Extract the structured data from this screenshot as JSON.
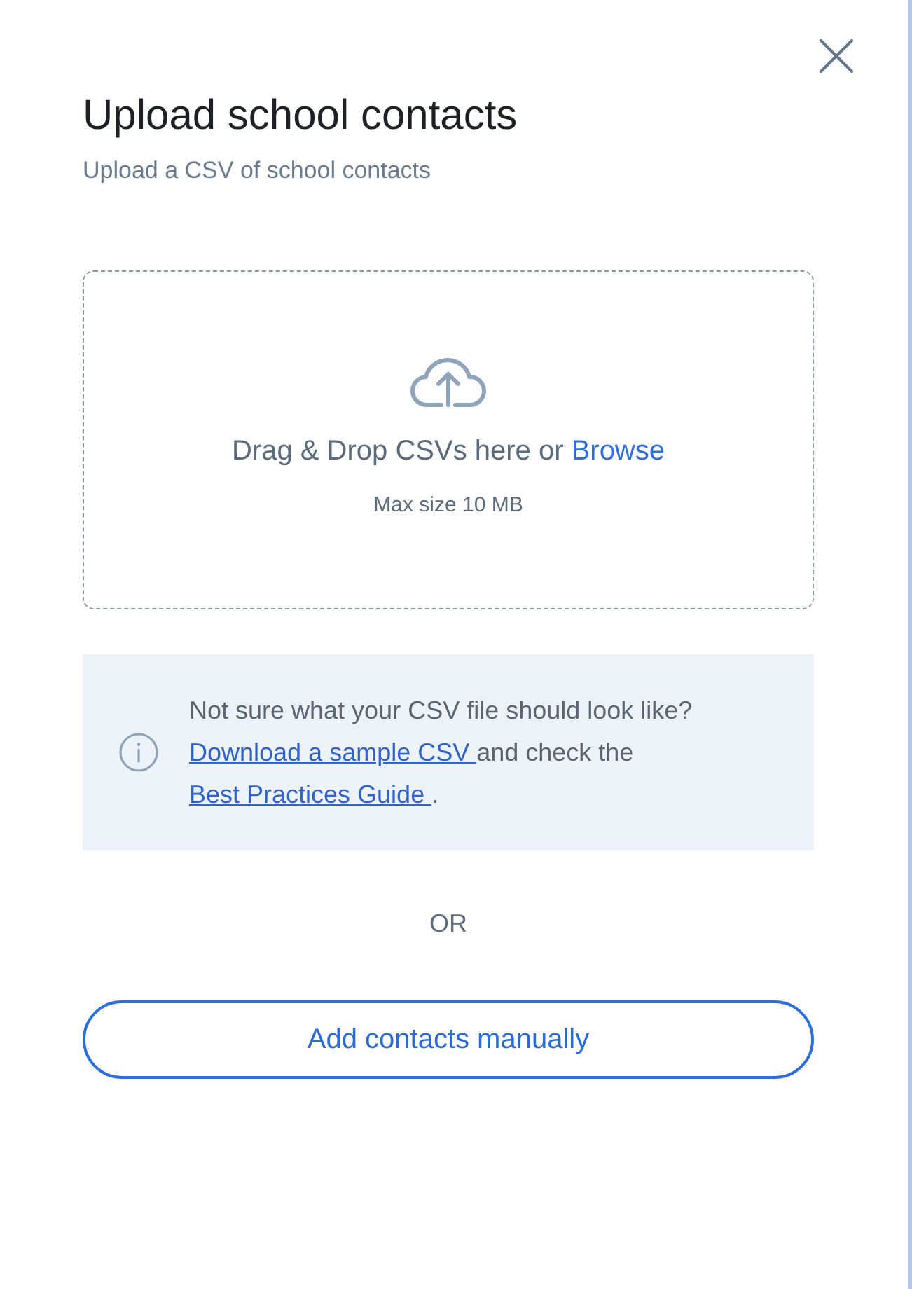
{
  "header": {
    "title": "Upload school contacts",
    "subtitle": "Upload a CSV of school contacts"
  },
  "dropzone": {
    "prompt": "Drag & Drop CSVs here or",
    "browse_link": "Browse",
    "note": "Max size 10 MB"
  },
  "info": {
    "parts": [
      {
        "kind": "text",
        "text": "Not sure what your CSV file should look like? "
      },
      {
        "kind": "link",
        "text": "Download a sample CSV "
      },
      {
        "kind": "text",
        "text": "and check the "
      },
      {
        "kind": "link",
        "text": "Best Practices Guide "
      },
      {
        "kind": "text",
        "text": "."
      }
    ]
  },
  "separator": "OR",
  "buttons": [
    {
      "label": "Add contacts manually"
    }
  ]
}
